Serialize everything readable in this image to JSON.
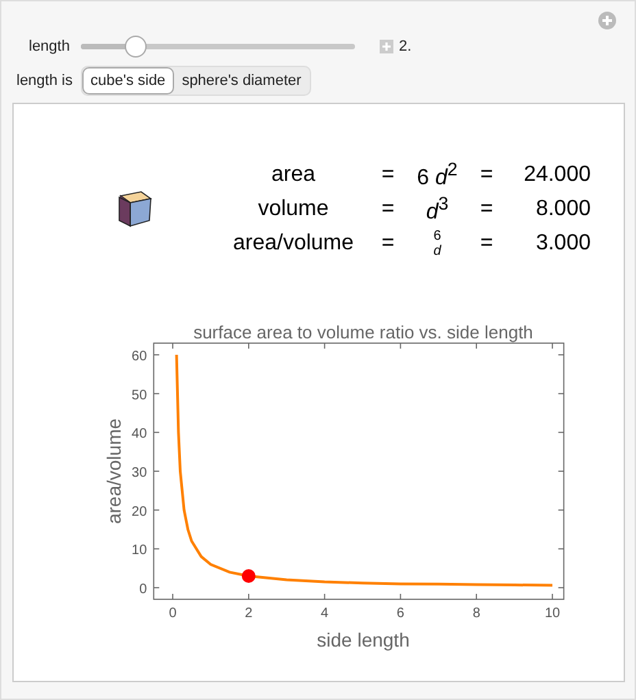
{
  "controls": {
    "slider": {
      "label": "length",
      "level": 0.2,
      "reading": "2."
    },
    "mode": {
      "label": "length is",
      "options": [
        {
          "label": "cube's side",
          "selected": true
        },
        {
          "label": "sphere's diameter",
          "selected": false
        }
      ]
    }
  },
  "formulas": [
    {
      "kind": "inline",
      "label": "area",
      "eq1": "=",
      "expr": "6 *d*$^{2}$",
      "eq2": "=",
      "value": "24.000"
    },
    {
      "kind": "inline",
      "label": "volume",
      "eq1": "=",
      "expr": "*d*$^{3}$",
      "eq2": "=",
      "value": "8.000"
    },
    {
      "kind": "fraction",
      "label": "area/volume",
      "eq1": "=",
      "numerator": "6",
      "denominator": "d",
      "eq2": "=",
      "value": "3.000"
    }
  ],
  "chart": {
    "chart_data": {
      "type": "line",
      "title": "surface area to volume ratio vs. side length",
      "xlabel": "side length",
      "ylabel": "area/volume",
      "x": [
        0.1,
        0.15,
        0.2,
        0.3,
        0.4,
        0.5,
        0.75,
        1,
        1.5,
        2,
        3,
        4,
        5,
        6,
        7,
        8,
        9,
        10
      ],
      "series": [
        {
          "color": "#ff8000",
          "values": [
            60,
            40,
            30,
            20,
            15,
            12,
            8,
            6,
            4,
            3,
            2,
            1.5,
            1.2,
            1,
            0.9,
            0.8,
            0.7,
            0.6
          ]
        },
        {
          "color": "#ff0000",
          "marker": "circle",
          "values": [
            null,
            null,
            null,
            null,
            null,
            null,
            null,
            null,
            null,
            3,
            null,
            null,
            null,
            null,
            null,
            null,
            null,
            null
          ]
        }
      ],
      "xlim": [
        -0.5,
        10.3
      ],
      "ylim": [
        -3,
        63
      ],
      "xticks": [
        0,
        2,
        4,
        6,
        8,
        10
      ],
      "yticks": [
        0,
        10,
        20,
        30,
        40,
        50,
        60
      ]
    }
  }
}
